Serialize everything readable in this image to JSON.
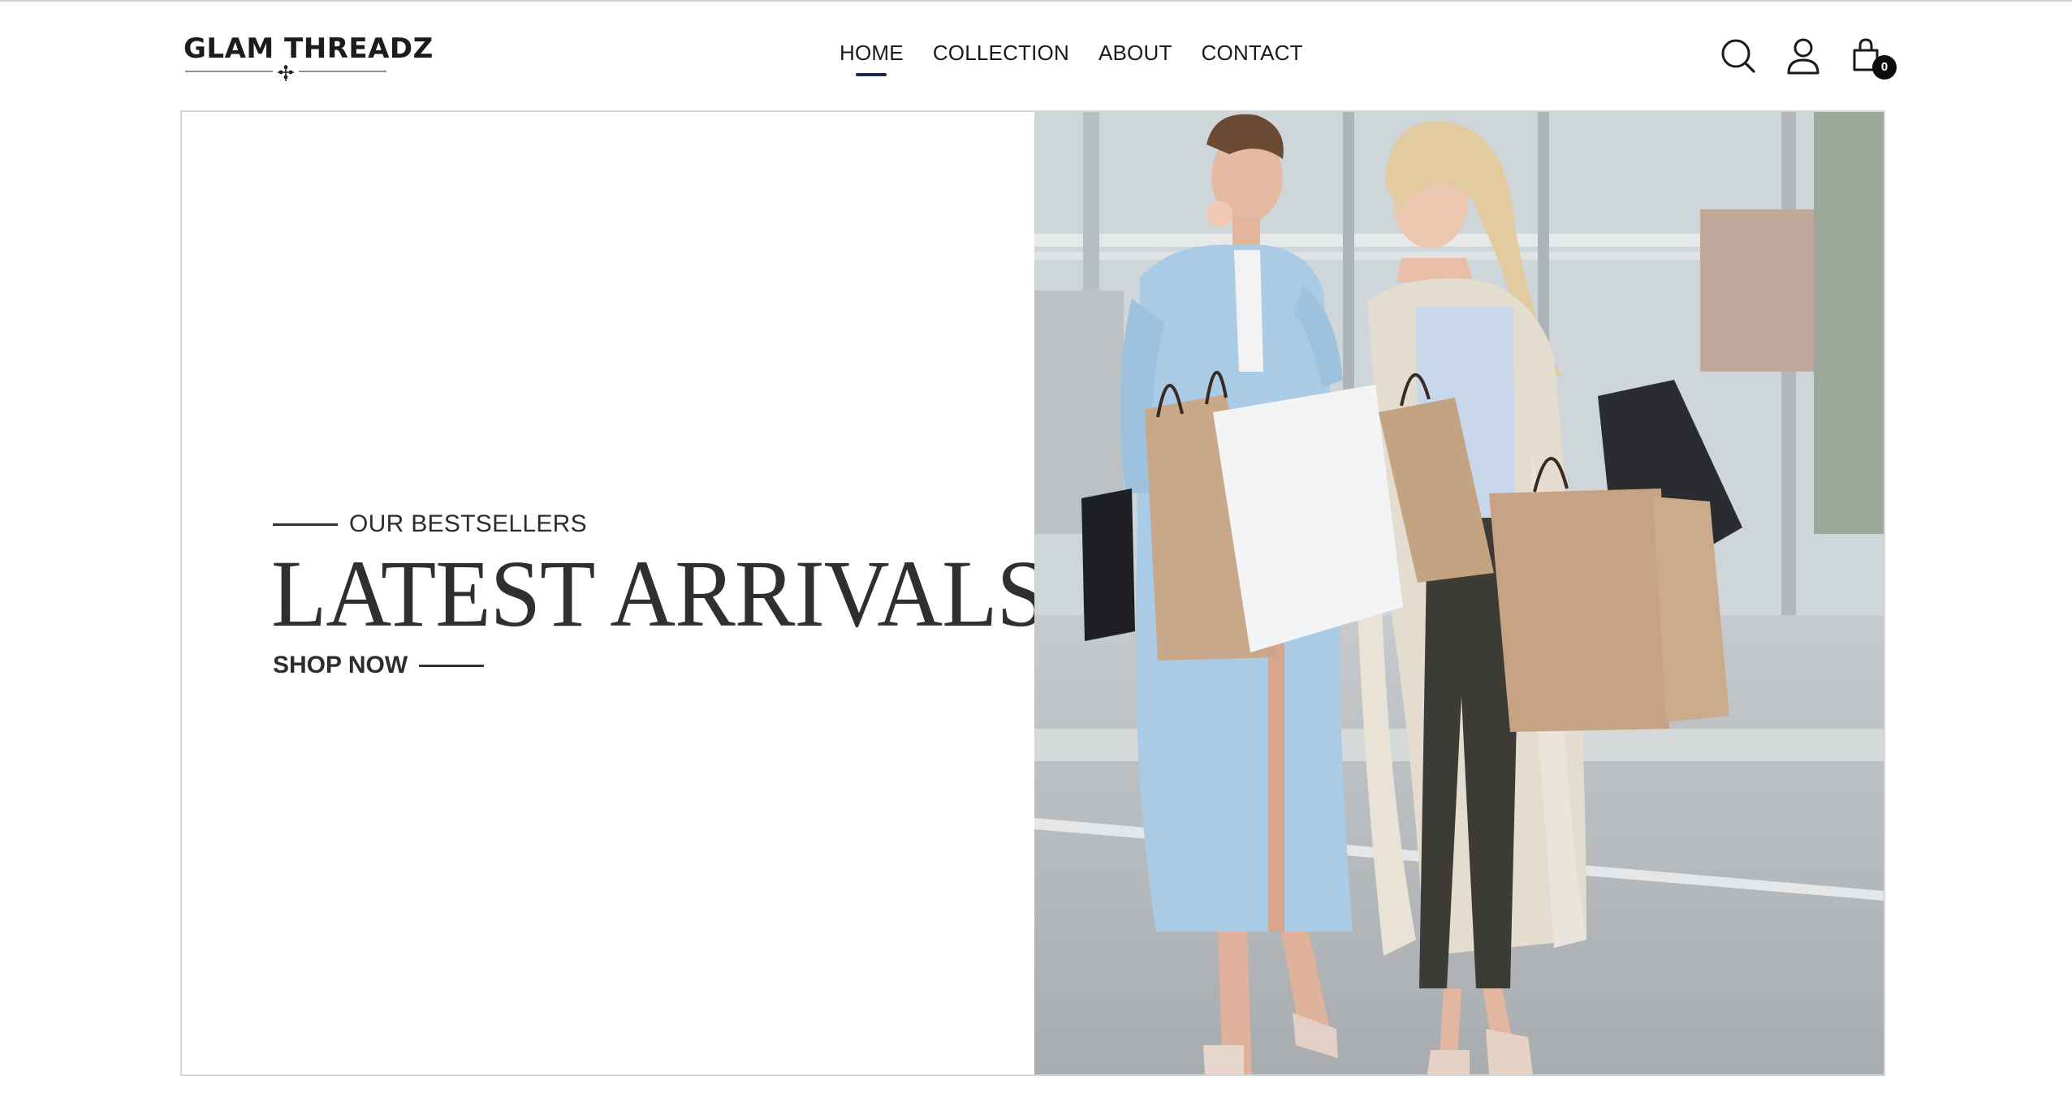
{
  "brand": {
    "name": "GLAM THREADZ"
  },
  "nav": {
    "items": [
      {
        "label": "HOME",
        "active": true
      },
      {
        "label": "COLLECTION",
        "active": false
      },
      {
        "label": "ABOUT",
        "active": false
      },
      {
        "label": "CONTACT",
        "active": false
      }
    ]
  },
  "header_icons": {
    "search": "search-icon",
    "account": "user-icon",
    "cart": "shopping-bag-icon",
    "cart_count": "0"
  },
  "hero": {
    "eyebrow": "OUR BESTSELLERS",
    "title": "LATEST ARRIVALS",
    "cta": "SHOP NOW",
    "image": "two-women-with-shopping-bags"
  },
  "colors": {
    "text_dark": "#2f2f2f",
    "nav_underline": "#1c2a4a",
    "badge": "#0d0d0d",
    "border": "#d6d6d6"
  }
}
